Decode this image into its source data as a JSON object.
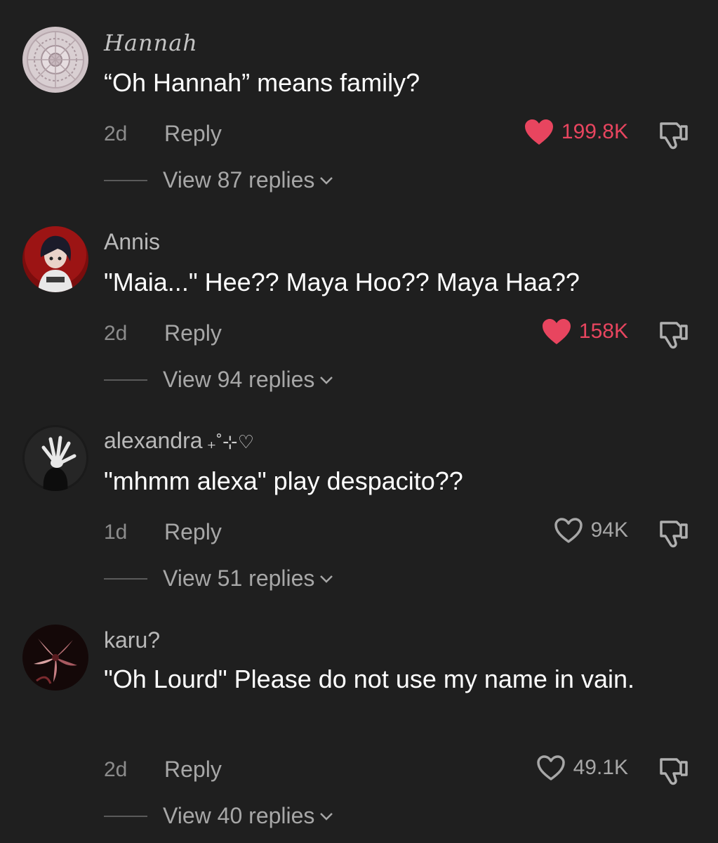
{
  "comments": [
    {
      "username": "Hannah",
      "username_deco": "",
      "text": "“Oh Hannah” means family?",
      "time": "2d",
      "reply_label": "Reply",
      "likes": "199.8K",
      "liked": true,
      "replies_label": "View 87 replies",
      "avatar": "lace-doily-avatar"
    },
    {
      "username": "Annis",
      "username_deco": "",
      "text": "\"Maia...\" Hee?? Maya Hoo?? Maya Haa??",
      "time": "2d",
      "reply_label": "Reply",
      "likes": "158K",
      "liked": true,
      "replies_label": "View 94 replies",
      "avatar": "anime-character-avatar"
    },
    {
      "username": "alexandra",
      "username_deco": "₊˚⊹♡",
      "text": "\"mhmm alexa\" play despacito??",
      "time": "1d",
      "reply_label": "Reply",
      "likes": "94K",
      "liked": false,
      "replies_label": "View 51 replies",
      "avatar": "hand-silhouette-avatar"
    },
    {
      "username": "karu?",
      "username_deco": "",
      "text": "\"Oh Lourd\" Please do not use my name in vain.",
      "time": "2d",
      "reply_label": "Reply",
      "likes": "49.1K",
      "liked": false,
      "replies_label": "View 40 replies",
      "avatar": "lily-flower-avatar"
    }
  ],
  "colors": {
    "background": "#1f1f1f",
    "liked": "#e8455f",
    "muted": "#a7a7a7"
  }
}
